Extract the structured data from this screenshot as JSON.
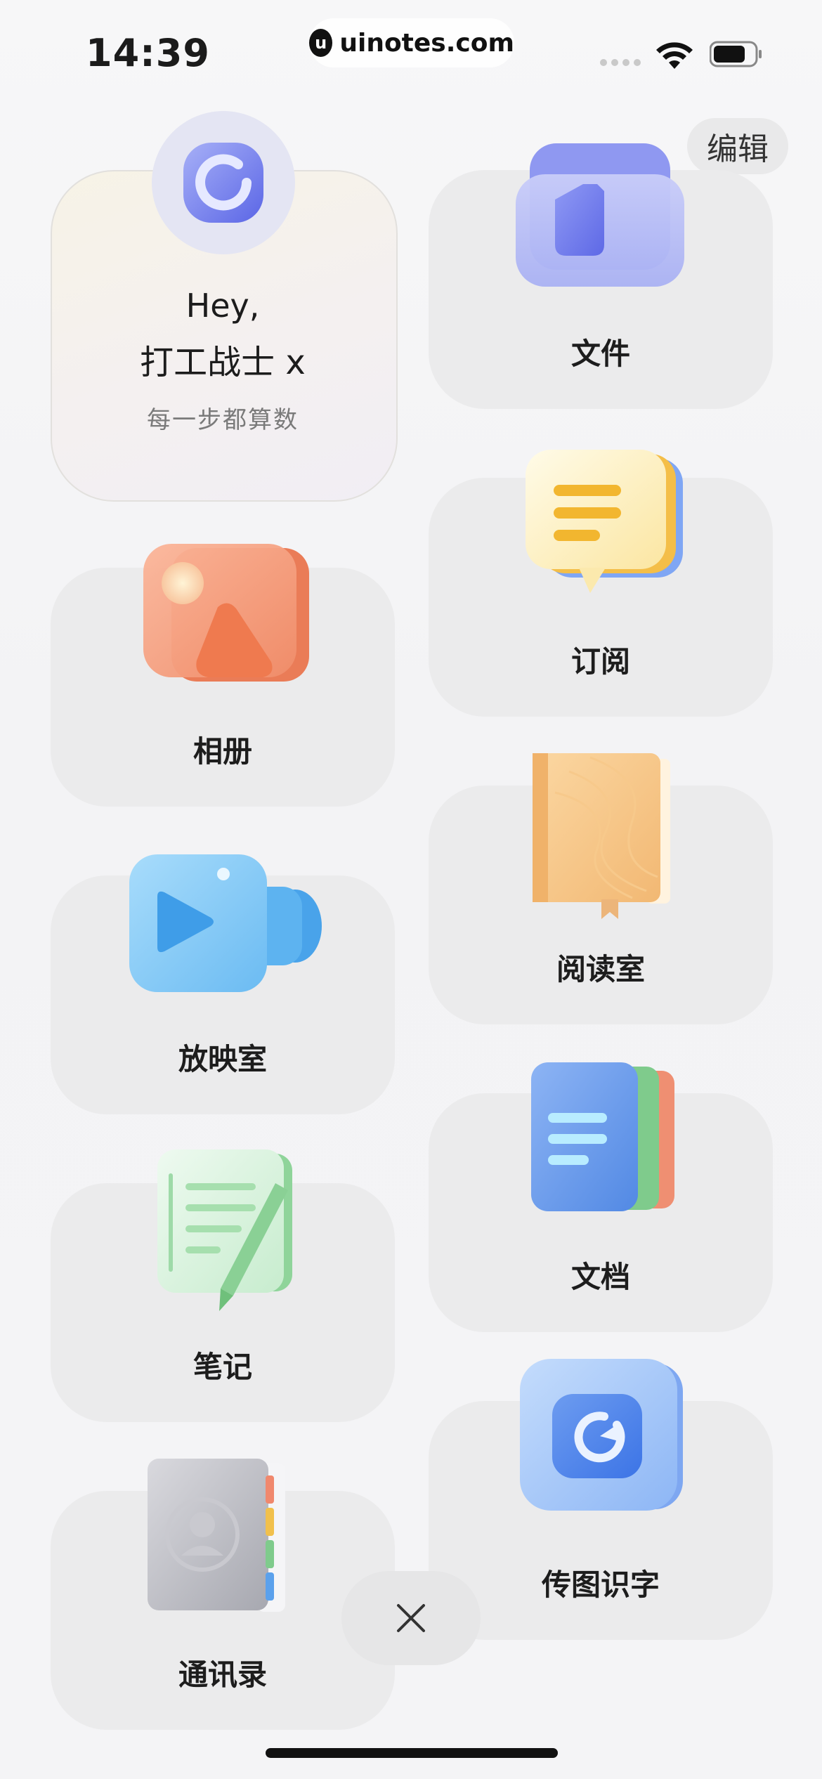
{
  "status_bar": {
    "time": "14:39",
    "watermark": "uinotes.com",
    "watermark_logo": "u"
  },
  "header": {
    "edit_label": "编辑"
  },
  "profile": {
    "greeting": "Hey,",
    "username": "打工战士 x",
    "motto": "每一步都算数",
    "avatar_icon": "refresh-ring-icon"
  },
  "apps": {
    "files": {
      "label": "文件",
      "icon": "folder-icon"
    },
    "subscriptions": {
      "label": "订阅",
      "icon": "chat-bubble-icon"
    },
    "album": {
      "label": "相册",
      "icon": "photo-icon"
    },
    "reading_room": {
      "label": "阅读室",
      "icon": "book-icon"
    },
    "cinema": {
      "label": "放映室",
      "icon": "video-camera-icon"
    },
    "documents": {
      "label": "文档",
      "icon": "document-stack-icon"
    },
    "notes": {
      "label": "笔记",
      "icon": "notepad-pen-icon"
    },
    "image_to_text": {
      "label": "传图识字",
      "icon": "ocr-icon"
    },
    "contacts": {
      "label": "通讯录",
      "icon": "address-book-icon"
    }
  },
  "colors": {
    "accent": "#6f7cf0",
    "card_bg": "#ebebec",
    "orange": "#f08a5d",
    "blue": "#4aa6ee",
    "green": "#8fd49a",
    "yellow": "#f4c34e"
  }
}
